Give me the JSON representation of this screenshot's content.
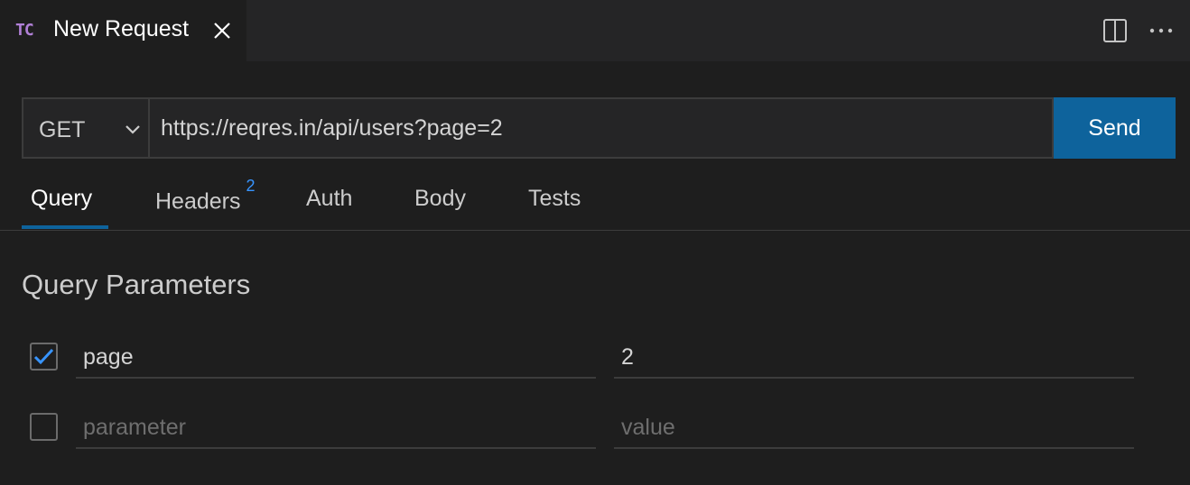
{
  "tab": {
    "badge": "TC",
    "title": "New Request"
  },
  "request": {
    "method": "GET",
    "url": "https://reqres.in/api/users?page=2",
    "send_label": "Send"
  },
  "request_tabs": [
    {
      "label": "Query",
      "active": true
    },
    {
      "label": "Headers",
      "count": "2"
    },
    {
      "label": "Auth"
    },
    {
      "label": "Body"
    },
    {
      "label": "Tests"
    }
  ],
  "query": {
    "title": "Query Parameters",
    "params": [
      {
        "checked": true,
        "key": "page",
        "value": "2"
      },
      {
        "checked": false,
        "key": "",
        "value": "",
        "key_placeholder": "parameter",
        "value_placeholder": "value"
      }
    ]
  },
  "colors": {
    "accent": "#0e639c",
    "badge": "#b180d7",
    "count": "#3794ff",
    "checkmark": "#3794ff"
  },
  "icons": {
    "close": "close-icon",
    "split": "split-editor-icon",
    "more": "more-actions-icon",
    "chevron": "chevron-down-icon",
    "check": "checkmark-icon"
  }
}
